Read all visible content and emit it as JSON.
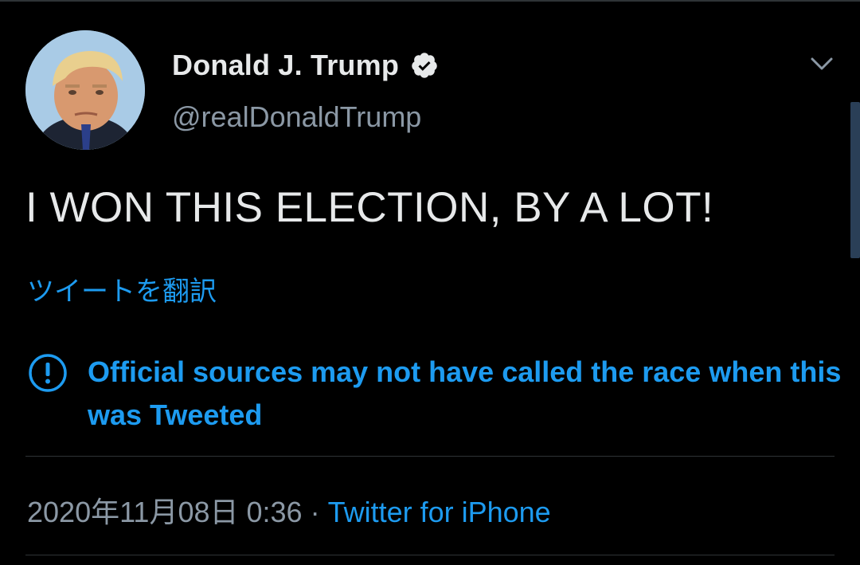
{
  "tweet": {
    "author": {
      "display_name": "Donald J. Trump",
      "handle": "@realDonaldTrump",
      "verified": true
    },
    "text": "I WON THIS ELECTION, BY A LOT!",
    "translate_label": "ツイートを翻訳",
    "notice": {
      "icon": "exclamation-circle-icon",
      "text": "Official sources may not have called the race when this was Tweeted"
    },
    "timestamp": "2020年11月08日 0:36",
    "separator": "·",
    "source": "Twitter for iPhone",
    "menu_icon": "chevron-down-icon"
  },
  "colors": {
    "background": "#000000",
    "text_primary": "#e7e9ea",
    "text_secondary": "#8b98a5",
    "accent_blue": "#1d9bf0",
    "divider": "#2f3336"
  }
}
